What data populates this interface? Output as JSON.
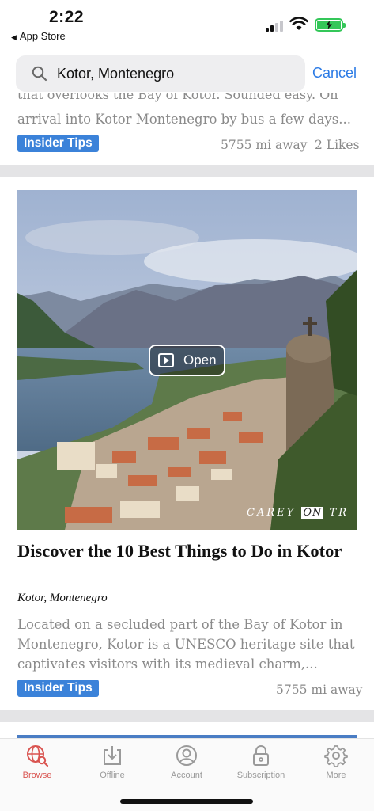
{
  "status_bar": {
    "time": "2:22",
    "back_app": "App Store"
  },
  "search": {
    "value": "Kotor, Montenegro",
    "cancel_label": "Cancel"
  },
  "card1": {
    "clipped_line": "that overlooks the Bay of Kotor. Sounded easy. On",
    "description": "arrival into Kotor Montenegro by bus a few days...",
    "badge": "Insider Tips",
    "distance": "5755 mi away",
    "likes": "2 Likes"
  },
  "card2": {
    "open_label": "Open",
    "watermark": {
      "left": "CAREY",
      "mid": "ON",
      "right": "TR"
    },
    "title": "Discover the 10 Best Things to Do in Kotor",
    "location": "Kotor, Montenegro",
    "description": "Located on a secluded part of the Bay of Kotor in Montenegro, Kotor is a UNESCO heritage site that captivates visitors with its medieval charm,...",
    "badge": "Insider Tips",
    "distance": "5755 mi away"
  },
  "tabs": [
    {
      "label": "Browse",
      "icon": "globe-search-icon",
      "active": true
    },
    {
      "label": "Offline",
      "icon": "download-icon",
      "active": false
    },
    {
      "label": "Account",
      "icon": "person-icon",
      "active": false
    },
    {
      "label": "Subscription",
      "icon": "lock-icon",
      "active": false
    },
    {
      "label": "More",
      "icon": "gear-icon",
      "active": false
    }
  ],
  "colors": {
    "accent": "#2c7be5",
    "badge": "#3b82d9",
    "active_tab": "#d9534f",
    "battery": "#34c759"
  }
}
